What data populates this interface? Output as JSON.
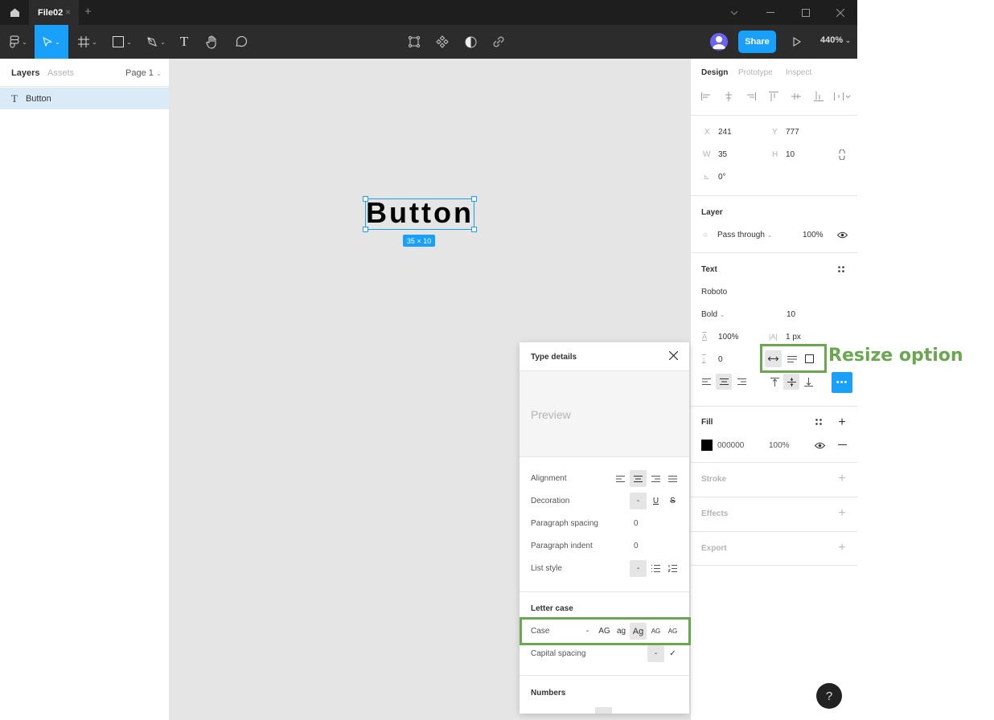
{
  "titlebar": {
    "tab_name": "File02",
    "tab_close": "×",
    "tab_add": "+",
    "window_controls": [
      "⌄",
      "—",
      "☐",
      "✕"
    ]
  },
  "toolbar": {
    "tools": [
      {
        "name": "main-menu",
        "icon": "figma-logo-icon",
        "has_chevron": true
      },
      {
        "name": "move",
        "icon": "cursor-arrow-icon",
        "has_chevron": true,
        "active": true
      },
      {
        "name": "frame",
        "icon": "frame-hash-icon",
        "has_chevron": true
      },
      {
        "name": "shape",
        "icon": "rectangle-icon",
        "has_chevron": true
      },
      {
        "name": "pen",
        "icon": "pen-icon",
        "has_chevron": true
      },
      {
        "name": "text",
        "icon": "text-icon",
        "glyph": "T"
      },
      {
        "name": "hand",
        "icon": "hand-icon"
      },
      {
        "name": "comment",
        "icon": "comment-icon"
      }
    ],
    "center_tools": [
      "frame-selection-icon",
      "component-icon",
      "mask-icon",
      "link-icon"
    ],
    "share_label": "Share",
    "zoom_level": "440%",
    "play_icon": "play-icon"
  },
  "left_panel": {
    "tabs": [
      "Layers",
      "Assets"
    ],
    "page_selector": "Page 1",
    "layers": [
      {
        "type": "text",
        "name": "Button",
        "selected": true
      }
    ]
  },
  "canvas": {
    "text_content": "Button",
    "size_badge": "35 × 10"
  },
  "type_details": {
    "title": "Type details",
    "preview": "Preview",
    "rows": {
      "alignment": "Alignment",
      "decoration": "Decoration",
      "decoration_none": "-",
      "paragraph_spacing": "Paragraph spacing",
      "paragraph_spacing_value": "0",
      "paragraph_indent": "Paragraph indent",
      "paragraph_indent_value": "0",
      "list_style": "List style",
      "list_none": "-"
    },
    "letter_case": {
      "section": "Letter case",
      "case_label": "Case",
      "case_options": [
        "-",
        "AG",
        "ag",
        "Ag",
        "AG",
        "AG"
      ],
      "case_selected": "Ag",
      "capital_spacing": "Capital spacing",
      "capital_spacing_none": "-",
      "capital_spacing_check": "✓"
    },
    "numbers": {
      "section": "Numbers"
    }
  },
  "right_panel": {
    "tabs": [
      "Design",
      "Prototype",
      "Inspect"
    ],
    "position": {
      "x_label": "X",
      "x": "241",
      "y_label": "Y",
      "y": "777",
      "w_label": "W",
      "w": "35",
      "h_label": "H",
      "h": "10",
      "rotation": "0°"
    },
    "layer": {
      "title": "Layer",
      "blend": "Pass through",
      "opacity": "100%"
    },
    "text": {
      "title": "Text",
      "font_family": "Roboto",
      "font_weight": "Bold",
      "font_size": "10",
      "line_height": "100%",
      "letter_spacing": "1 px",
      "paragraph_spacing": "0",
      "resize_selected": "auto-width"
    },
    "fill": {
      "title": "Fill",
      "hex": "000000",
      "opacity": "100%",
      "color": "#000000"
    },
    "stroke": {
      "title": "Stroke"
    },
    "effects": {
      "title": "Effects"
    },
    "export": {
      "title": "Export"
    }
  },
  "annotations": {
    "resize_label": "Resize option",
    "color": "#6aa84f"
  },
  "help": "?",
  "colors": {
    "accent": "#18a0fb",
    "toolbar": "#2c2c2c",
    "titlebar": "#1e1e1e",
    "canvas": "#e5e5e5",
    "selected_layer": "#daebf7"
  }
}
